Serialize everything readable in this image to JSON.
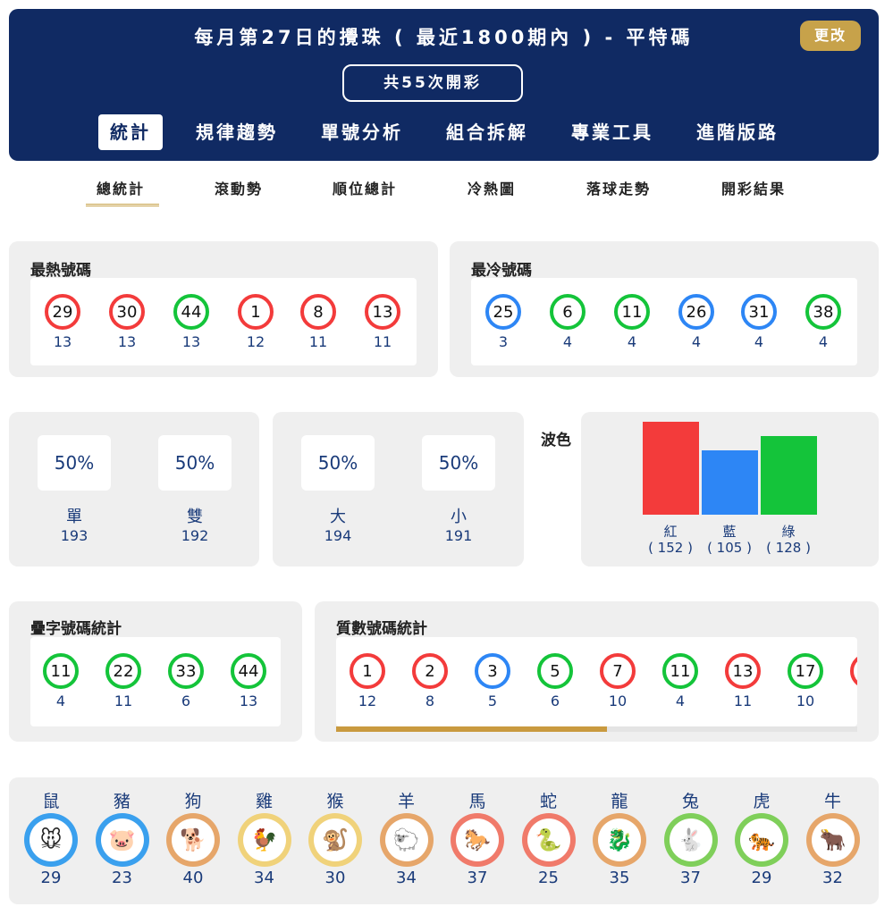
{
  "header": {
    "title": "每月第27日的攪珠 ( 最近1800期內 ) - 平特碼",
    "change_label": "更改",
    "total_label": "共55次開彩",
    "tabs": [
      "統計",
      "規律趨勢",
      "單號分析",
      "組合拆解",
      "專業工具",
      "進階版路"
    ]
  },
  "subtabs": [
    "總統計",
    "滾動勢",
    "順位總計",
    "冷熱圖",
    "落球走勢",
    "開彩結果"
  ],
  "hot": {
    "title": "最熱號碼",
    "balls": [
      {
        "num": "29",
        "count": "13",
        "color": "red"
      },
      {
        "num": "30",
        "count": "13",
        "color": "red"
      },
      {
        "num": "44",
        "count": "13",
        "color": "green"
      },
      {
        "num": "1",
        "count": "12",
        "color": "red"
      },
      {
        "num": "8",
        "count": "11",
        "color": "red"
      },
      {
        "num": "13",
        "count": "11",
        "color": "red"
      }
    ]
  },
  "cold": {
    "title": "最冷號碼",
    "balls": [
      {
        "num": "25",
        "count": "3",
        "color": "blue"
      },
      {
        "num": "6",
        "count": "4",
        "color": "green"
      },
      {
        "num": "11",
        "count": "4",
        "color": "green"
      },
      {
        "num": "26",
        "count": "4",
        "color": "blue"
      },
      {
        "num": "31",
        "count": "4",
        "color": "blue"
      },
      {
        "num": "38",
        "count": "4",
        "color": "green"
      }
    ]
  },
  "odd_even": {
    "items": [
      {
        "pct": "50%",
        "label": "單",
        "count": "193"
      },
      {
        "pct": "50%",
        "label": "雙",
        "count": "192"
      }
    ]
  },
  "big_small": {
    "items": [
      {
        "pct": "50%",
        "label": "大",
        "count": "194"
      },
      {
        "pct": "50%",
        "label": "小",
        "count": "191"
      }
    ]
  },
  "wave": {
    "title": "波色",
    "colors": {
      "red": "#f33b3b",
      "blue": "#2d86f5",
      "green": "#14c43a"
    }
  },
  "chart_data": {
    "type": "bar",
    "categories": [
      "紅",
      "藍",
      "綠"
    ],
    "values": [
      152,
      105,
      128
    ],
    "value_labels": [
      "( 152 )",
      "( 105 )",
      "( 128 )"
    ],
    "title": "波色",
    "ylim": [
      0,
      152
    ]
  },
  "double": {
    "title": "疊字號碼統計",
    "balls": [
      {
        "num": "11",
        "count": "4",
        "color": "green"
      },
      {
        "num": "22",
        "count": "11",
        "color": "green"
      },
      {
        "num": "33",
        "count": "6",
        "color": "green"
      },
      {
        "num": "44",
        "count": "13",
        "color": "green"
      }
    ]
  },
  "prime": {
    "title": "質數號碼統計",
    "balls": [
      {
        "num": "1",
        "count": "12",
        "color": "red"
      },
      {
        "num": "2",
        "count": "8",
        "color": "red"
      },
      {
        "num": "3",
        "count": "5",
        "color": "blue"
      },
      {
        "num": "5",
        "count": "6",
        "color": "green"
      },
      {
        "num": "7",
        "count": "10",
        "color": "red"
      },
      {
        "num": "11",
        "count": "4",
        "color": "green"
      },
      {
        "num": "13",
        "count": "11",
        "color": "red"
      },
      {
        "num": "17",
        "count": "10",
        "color": "green"
      }
    ],
    "scroll_fraction": 0.52
  },
  "zodiac": [
    {
      "name": "鼠",
      "count": "29",
      "ring": "#3aa0ee",
      "glyph": "🐭",
      "icon": "rat-icon"
    },
    {
      "name": "豬",
      "count": "23",
      "ring": "#3aa0ee",
      "glyph": "🐷",
      "icon": "pig-icon"
    },
    {
      "name": "狗",
      "count": "40",
      "ring": "#e6a66a",
      "glyph": "🐕",
      "icon": "dog-icon"
    },
    {
      "name": "雞",
      "count": "34",
      "ring": "#f0d27a",
      "glyph": "🐓",
      "icon": "rooster-icon"
    },
    {
      "name": "猴",
      "count": "30",
      "ring": "#f0d27a",
      "glyph": "🐒",
      "icon": "monkey-icon"
    },
    {
      "name": "羊",
      "count": "34",
      "ring": "#e6a66a",
      "glyph": "🐑",
      "icon": "goat-icon"
    },
    {
      "name": "馬",
      "count": "37",
      "ring": "#f07a6a",
      "glyph": "🐎",
      "icon": "horse-icon"
    },
    {
      "name": "蛇",
      "count": "25",
      "ring": "#f07a6a",
      "glyph": "🐍",
      "icon": "snake-icon"
    },
    {
      "name": "龍",
      "count": "35",
      "ring": "#e6a66a",
      "glyph": "🐉",
      "icon": "dragon-icon"
    },
    {
      "name": "兔",
      "count": "37",
      "ring": "#7fcf5a",
      "glyph": "🐇",
      "icon": "rabbit-icon"
    },
    {
      "name": "虎",
      "count": "29",
      "ring": "#7fcf5a",
      "glyph": "🐅",
      "icon": "tiger-icon"
    },
    {
      "name": "牛",
      "count": "32",
      "ring": "#e6a66a",
      "glyph": "🐂",
      "icon": "ox-icon"
    }
  ]
}
